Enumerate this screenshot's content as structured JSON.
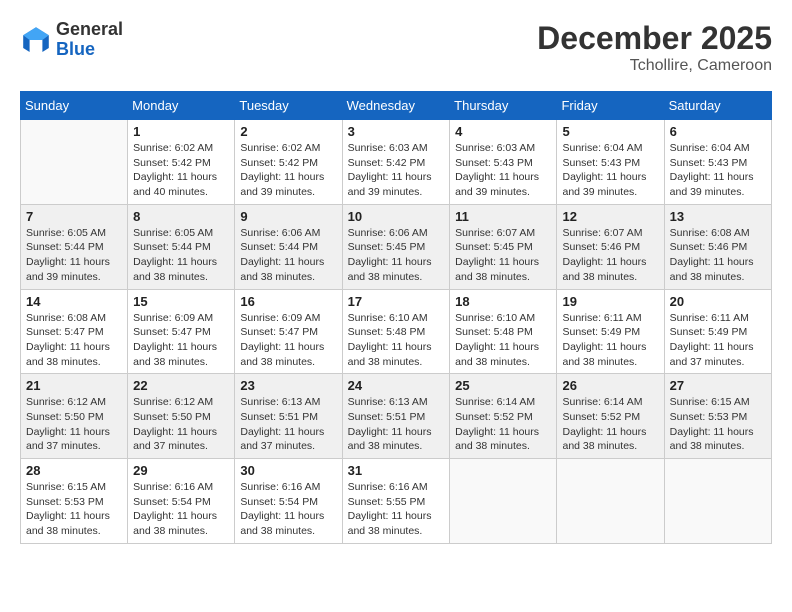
{
  "header": {
    "logo_line1": "General",
    "logo_line2": "Blue",
    "month": "December 2025",
    "location": "Tchollire, Cameroon"
  },
  "weekdays": [
    "Sunday",
    "Monday",
    "Tuesday",
    "Wednesday",
    "Thursday",
    "Friday",
    "Saturday"
  ],
  "weeks": [
    [
      {
        "day": "",
        "info": ""
      },
      {
        "day": "1",
        "info": "Sunrise: 6:02 AM\nSunset: 5:42 PM\nDaylight: 11 hours\nand 40 minutes."
      },
      {
        "day": "2",
        "info": "Sunrise: 6:02 AM\nSunset: 5:42 PM\nDaylight: 11 hours\nand 39 minutes."
      },
      {
        "day": "3",
        "info": "Sunrise: 6:03 AM\nSunset: 5:42 PM\nDaylight: 11 hours\nand 39 minutes."
      },
      {
        "day": "4",
        "info": "Sunrise: 6:03 AM\nSunset: 5:43 PM\nDaylight: 11 hours\nand 39 minutes."
      },
      {
        "day": "5",
        "info": "Sunrise: 6:04 AM\nSunset: 5:43 PM\nDaylight: 11 hours\nand 39 minutes."
      },
      {
        "day": "6",
        "info": "Sunrise: 6:04 AM\nSunset: 5:43 PM\nDaylight: 11 hours\nand 39 minutes."
      }
    ],
    [
      {
        "day": "7",
        "info": "Sunrise: 6:05 AM\nSunset: 5:44 PM\nDaylight: 11 hours\nand 39 minutes."
      },
      {
        "day": "8",
        "info": "Sunrise: 6:05 AM\nSunset: 5:44 PM\nDaylight: 11 hours\nand 38 minutes."
      },
      {
        "day": "9",
        "info": "Sunrise: 6:06 AM\nSunset: 5:44 PM\nDaylight: 11 hours\nand 38 minutes."
      },
      {
        "day": "10",
        "info": "Sunrise: 6:06 AM\nSunset: 5:45 PM\nDaylight: 11 hours\nand 38 minutes."
      },
      {
        "day": "11",
        "info": "Sunrise: 6:07 AM\nSunset: 5:45 PM\nDaylight: 11 hours\nand 38 minutes."
      },
      {
        "day": "12",
        "info": "Sunrise: 6:07 AM\nSunset: 5:46 PM\nDaylight: 11 hours\nand 38 minutes."
      },
      {
        "day": "13",
        "info": "Sunrise: 6:08 AM\nSunset: 5:46 PM\nDaylight: 11 hours\nand 38 minutes."
      }
    ],
    [
      {
        "day": "14",
        "info": "Sunrise: 6:08 AM\nSunset: 5:47 PM\nDaylight: 11 hours\nand 38 minutes."
      },
      {
        "day": "15",
        "info": "Sunrise: 6:09 AM\nSunset: 5:47 PM\nDaylight: 11 hours\nand 38 minutes."
      },
      {
        "day": "16",
        "info": "Sunrise: 6:09 AM\nSunset: 5:47 PM\nDaylight: 11 hours\nand 38 minutes."
      },
      {
        "day": "17",
        "info": "Sunrise: 6:10 AM\nSunset: 5:48 PM\nDaylight: 11 hours\nand 38 minutes."
      },
      {
        "day": "18",
        "info": "Sunrise: 6:10 AM\nSunset: 5:48 PM\nDaylight: 11 hours\nand 38 minutes."
      },
      {
        "day": "19",
        "info": "Sunrise: 6:11 AM\nSunset: 5:49 PM\nDaylight: 11 hours\nand 38 minutes."
      },
      {
        "day": "20",
        "info": "Sunrise: 6:11 AM\nSunset: 5:49 PM\nDaylight: 11 hours\nand 37 minutes."
      }
    ],
    [
      {
        "day": "21",
        "info": "Sunrise: 6:12 AM\nSunset: 5:50 PM\nDaylight: 11 hours\nand 37 minutes."
      },
      {
        "day": "22",
        "info": "Sunrise: 6:12 AM\nSunset: 5:50 PM\nDaylight: 11 hours\nand 37 minutes."
      },
      {
        "day": "23",
        "info": "Sunrise: 6:13 AM\nSunset: 5:51 PM\nDaylight: 11 hours\nand 37 minutes."
      },
      {
        "day": "24",
        "info": "Sunrise: 6:13 AM\nSunset: 5:51 PM\nDaylight: 11 hours\nand 38 minutes."
      },
      {
        "day": "25",
        "info": "Sunrise: 6:14 AM\nSunset: 5:52 PM\nDaylight: 11 hours\nand 38 minutes."
      },
      {
        "day": "26",
        "info": "Sunrise: 6:14 AM\nSunset: 5:52 PM\nDaylight: 11 hours\nand 38 minutes."
      },
      {
        "day": "27",
        "info": "Sunrise: 6:15 AM\nSunset: 5:53 PM\nDaylight: 11 hours\nand 38 minutes."
      }
    ],
    [
      {
        "day": "28",
        "info": "Sunrise: 6:15 AM\nSunset: 5:53 PM\nDaylight: 11 hours\nand 38 minutes."
      },
      {
        "day": "29",
        "info": "Sunrise: 6:16 AM\nSunset: 5:54 PM\nDaylight: 11 hours\nand 38 minutes."
      },
      {
        "day": "30",
        "info": "Sunrise: 6:16 AM\nSunset: 5:54 PM\nDaylight: 11 hours\nand 38 minutes."
      },
      {
        "day": "31",
        "info": "Sunrise: 6:16 AM\nSunset: 5:55 PM\nDaylight: 11 hours\nand 38 minutes."
      },
      {
        "day": "",
        "info": ""
      },
      {
        "day": "",
        "info": ""
      },
      {
        "day": "",
        "info": ""
      }
    ]
  ]
}
